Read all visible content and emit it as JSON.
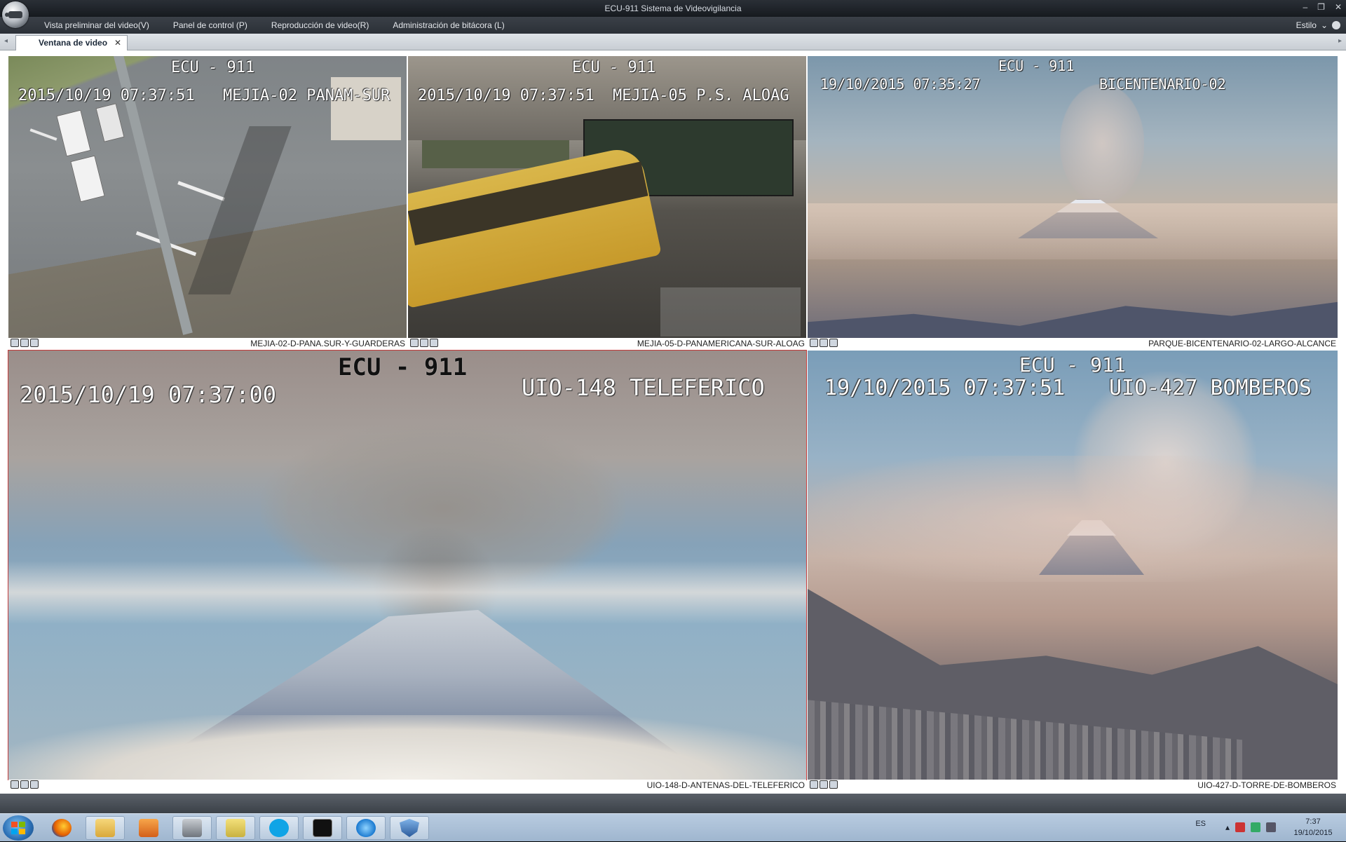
{
  "window": {
    "title": "ECU-911 Sistema de Videovigilancia",
    "controls": [
      "–",
      "❐",
      "✕"
    ]
  },
  "menu": {
    "items": [
      "Vista preliminar del video(V)",
      "Panel de control (P)",
      "Reproducción de video(R)",
      "Administración de bitácora (L)"
    ],
    "style_label": "Estilo",
    "style_arrow": "⌄"
  },
  "tabs": {
    "active_label": "Ventana de video",
    "close": "✕",
    "left_arrow": "◂",
    "right_arrow": "▸"
  },
  "cameras": [
    {
      "header": "ECU - 911",
      "timestamp": "2015/10/19 07:37:51",
      "label": "MEJIA-02 PANAM-SUR",
      "status_name": "MEJIA-02-D-PANA.SUR-Y-GUARDERAS"
    },
    {
      "header": "ECU - 911",
      "timestamp": "2015/10/19 07:37:51",
      "label": "MEJIA-05 P.S. ALOAG",
      "status_name": "MEJIA-05-D-PANAMERICANA-SUR-ALOAG"
    },
    {
      "header": "ECU - 911",
      "timestamp": "19/10/2015 07:35:27",
      "label": "BICENTENARIO-02",
      "status_name": "PARQUE-BICENTENARIO-02-LARGO-ALCANCE"
    },
    {
      "header": "ECU - 911",
      "timestamp": "2015/10/19 07:37:00",
      "label": "UIO-148 TELEFERICO",
      "status_name": "UIO-148-D-ANTENAS-DEL-TELEFERICO"
    },
    {
      "header": "ECU - 911",
      "timestamp": "19/10/2015 07:37:51",
      "label": "UIO-427 BOMBEROS",
      "status_name": "UIO-427-D-TORRE-DE-BOMBEROS"
    }
  ],
  "taskbar": {
    "language": "ES",
    "time": "7:37",
    "date": "19/10/2015",
    "tray_arrow": "▴"
  },
  "colors": {
    "selected_panel_border": "#c23b3b",
    "taskbar": "#a9bfd8"
  }
}
